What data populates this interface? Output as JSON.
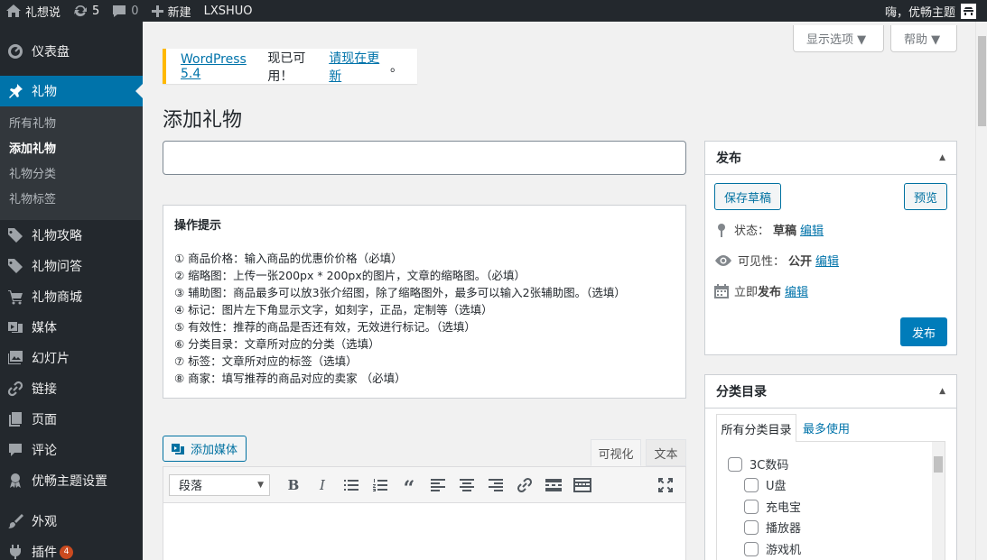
{
  "adminbar": {
    "site": "礼想说",
    "updates": "5",
    "comments": "0",
    "new": "新建",
    "user_link": "LXSHUO",
    "greeting": "嗨，优畅主题"
  },
  "menu": {
    "dashboard": "仪表盘",
    "gifts": "礼物",
    "sub": [
      "所有礼物",
      "添加礼物",
      "礼物分类",
      "礼物标签"
    ],
    "items": [
      "礼物攻略",
      "礼物问答",
      "礼物商城",
      "媒体",
      "幻灯片",
      "链接",
      "页面",
      "评论",
      "优畅主题设置",
      "外观",
      "插件"
    ],
    "plugin_badge": "4"
  },
  "screen_options": "显示选项 ▼",
  "help": "帮助 ▼",
  "notice": {
    "link1": "WordPress 5.4",
    "text": "现已可用！",
    "link2": "请现在更新",
    "end": "。"
  },
  "page_title": "添加礼物",
  "tips": {
    "title": "操作提示",
    "lines": [
      "① 商品价格：输入商品的优惠价价格（必填）",
      "② 缩略图：上传一张200px * 200px的图片，文章的缩略图。（必填）",
      "③ 辅助图：商品最多可以放3张介绍图，除了缩略图外，最多可以输入2张辅助图。（选填）",
      "④ 标记：图片左下角显示文字，如刻字，正品，定制等（选填）",
      "⑤ 有效性：推荐的商品是否还有效，无效进行标记。（选填）",
      "⑥ 分类目录：文章所对应的分类（选填）",
      "⑦ 标签：文章所对应的标签（选填）",
      "⑧ 商家：填写推荐的商品对应的卖家 （必填）"
    ]
  },
  "editor": {
    "add_media": "添加媒体",
    "tab_visual": "可视化",
    "tab_text": "文本",
    "format": "段落"
  },
  "publish": {
    "title": "发布",
    "save_draft": "保存草稿",
    "preview": "预览",
    "status_label": "状态：",
    "status": "草稿",
    "visibility_label": "可见性：",
    "visibility": "公开",
    "schedule_label": "立即",
    "schedule_suffix": "发布",
    "edit": "编辑",
    "publish_btn": "发布"
  },
  "categories": {
    "title": "分类目录",
    "tab_all": "所有分类目录",
    "tab_popular": "最多使用",
    "items": [
      "3C数码",
      "U盘",
      "充电宝",
      "播放器",
      "游戏机"
    ]
  }
}
